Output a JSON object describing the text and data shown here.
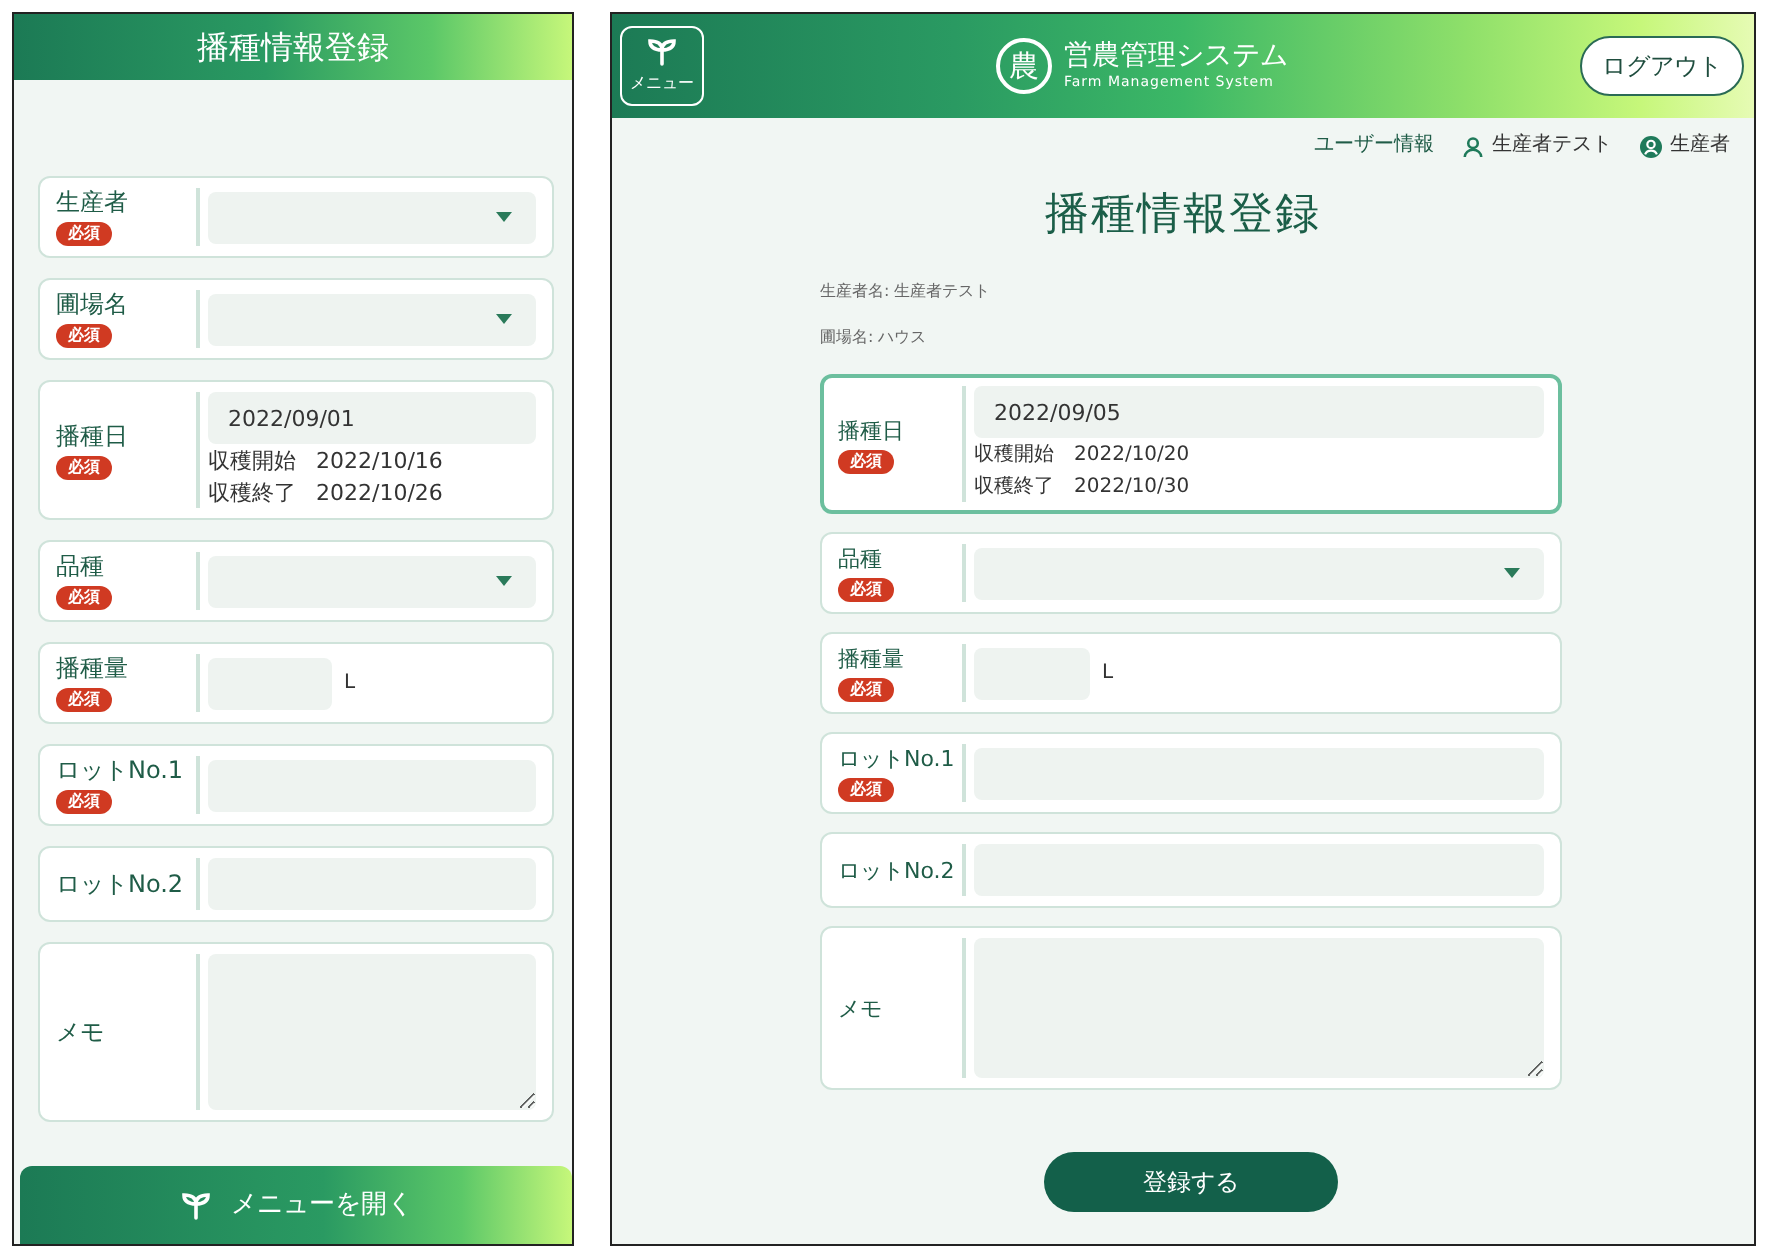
{
  "mobile": {
    "title": "播種情報登録",
    "fields": [
      {
        "kind": "select",
        "label": "生産者",
        "badge": "必須",
        "focused": false
      },
      {
        "kind": "select",
        "label": "圃場名",
        "badge": "必須",
        "focused": false
      },
      {
        "kind": "date",
        "label": "播種日",
        "badge": "必須",
        "focused": false,
        "value": "2022/09/01",
        "notes": [
          {
            "label": "収穫開始",
            "value": "2022/10/16"
          },
          {
            "label": "収穫終了",
            "value": "2022/10/26"
          }
        ]
      },
      {
        "kind": "select",
        "label": "品種",
        "badge": "必須",
        "focused": false
      },
      {
        "kind": "amount",
        "label": "播種量",
        "badge": "必須",
        "focused": false,
        "unit": "L"
      },
      {
        "kind": "text",
        "label": "ロットNo.1",
        "badge": "必須",
        "focused": false
      },
      {
        "kind": "text",
        "label": "ロットNo.2",
        "focused": false
      },
      {
        "kind": "textarea",
        "label": "メモ",
        "focused": false
      }
    ],
    "menu_button": "メニューを開く"
  },
  "desktop": {
    "menu_button": "メニュー",
    "logo_mark": "農",
    "app_name": "営農管理システム",
    "app_subtitle": "Farm Management System",
    "logout_button": "ログアウト",
    "user_links": [
      {
        "kind": "link",
        "label": "ユーザー情報"
      },
      {
        "kind": "user",
        "label": "生産者テスト"
      },
      {
        "kind": "role",
        "label": "生産者"
      }
    ],
    "title": "播種情報登録",
    "info": [
      "生産者名: 生産者テスト",
      "圃場名: ハウス"
    ],
    "fields": [
      {
        "kind": "date",
        "label": "播種日",
        "badge": "必須",
        "focused": true,
        "value": "2022/09/05",
        "notes": [
          {
            "label": "収穫開始",
            "value": "2022/10/20"
          },
          {
            "label": "収穫終了",
            "value": "2022/10/30"
          }
        ]
      },
      {
        "kind": "select",
        "label": "品種",
        "badge": "必須",
        "focused": false
      },
      {
        "kind": "amount",
        "label": "播種量",
        "badge": "必須",
        "focused": false,
        "unit": "L"
      },
      {
        "kind": "text",
        "label": "ロットNo.1",
        "badge": "必須",
        "focused": false
      },
      {
        "kind": "text",
        "label": "ロットNo.2",
        "focused": false
      },
      {
        "kind": "textarea",
        "label": "メモ",
        "focused": false
      }
    ],
    "submit_button": "登録する"
  }
}
